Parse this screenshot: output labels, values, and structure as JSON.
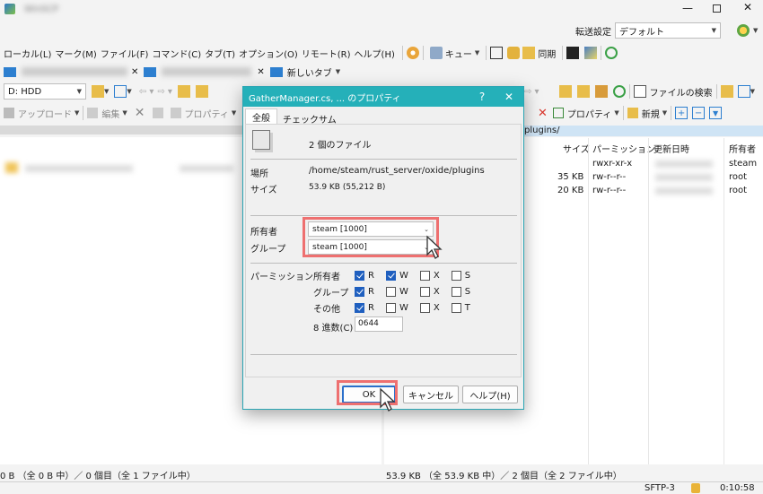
{
  "window": {
    "title_blurred": "WinSCP"
  },
  "settings_transfer": {
    "label": "転送設定",
    "value": "デフォルト"
  },
  "menu": [
    "ローカル(L)",
    "マーク(M)",
    "ファイル(F)",
    "コマンド(C)",
    "タブ(T)",
    "オプション(O)",
    "リモート(R)",
    "ヘルプ(H)"
  ],
  "toolbar1": {
    "queue": "キュー",
    "sync": "同期"
  },
  "tabs": {
    "new_tab": "新しいタブ"
  },
  "left": {
    "drive": "D: HDD",
    "upload": "アップロード",
    "edit": "編集",
    "properties": "プロパティ",
    "status": "0 B （全 0 B 中）／ 0 個目（全 1 ファイル中）"
  },
  "right": {
    "path_tail": "plugins/",
    "find_files": "ファイルの検索",
    "properties": "プロパティ",
    "new": "新規",
    "columns": {
      "size": "サイズ",
      "permission": "パーミッション",
      "modified": "更新日時",
      "owner": "所有者"
    },
    "rows": [
      {
        "size": "",
        "perm": "rwxr-xr-x",
        "owner": "steam"
      },
      {
        "size": "35 KB",
        "perm": "rw-r--r--",
        "owner": "root"
      },
      {
        "size": "20 KB",
        "perm": "rw-r--r--",
        "owner": "root"
      }
    ],
    "status": "53.9 KB （全 53.9 KB 中）／ 2 個目（全 2 ファイル中）"
  },
  "statusbar": {
    "protocol": "SFTP-3",
    "time": "0:10:58"
  },
  "dialog": {
    "title": "GatherManager.cs, ... のプロパティ",
    "help_glyph": "?",
    "close_glyph": "✕",
    "tabs": [
      "全般",
      "チェックサム"
    ],
    "file_count": "2 個のファイル",
    "location_label": "場所",
    "location_value": "/home/steam/rust_server/oxide/plugins",
    "size_label": "サイズ",
    "size_value": "53.9 KB (55,212 B)",
    "owner_label": "所有者",
    "owner_value": "steam [1000]",
    "group_label": "グループ",
    "group_value": "steam [1000]",
    "perm_label": "パーミッション",
    "perm_rows": [
      {
        "label": "所有者",
        "bits": [
          {
            "k": "R",
            "on": true
          },
          {
            "k": "W",
            "on": true
          },
          {
            "k": "X",
            "on": false
          },
          {
            "k": "S",
            "on": false
          }
        ]
      },
      {
        "label": "グループ",
        "bits": [
          {
            "k": "R",
            "on": true
          },
          {
            "k": "W",
            "on": false
          },
          {
            "k": "X",
            "on": false
          },
          {
            "k": "S",
            "on": false
          }
        ]
      },
      {
        "label": "その他",
        "bits": [
          {
            "k": "R",
            "on": true
          },
          {
            "k": "W",
            "on": false
          },
          {
            "k": "X",
            "on": false
          },
          {
            "k": "T",
            "on": false
          }
        ]
      }
    ],
    "octal_label": "8 進数(C)",
    "octal_value": "0644",
    "ok": "OK",
    "cancel": "キャンセル",
    "help": "ヘルプ(H)"
  },
  "colors": {
    "dialog_title": "#25b0b9",
    "highlight": "#ee7070",
    "checkbox_on": "#1f5fbf"
  }
}
